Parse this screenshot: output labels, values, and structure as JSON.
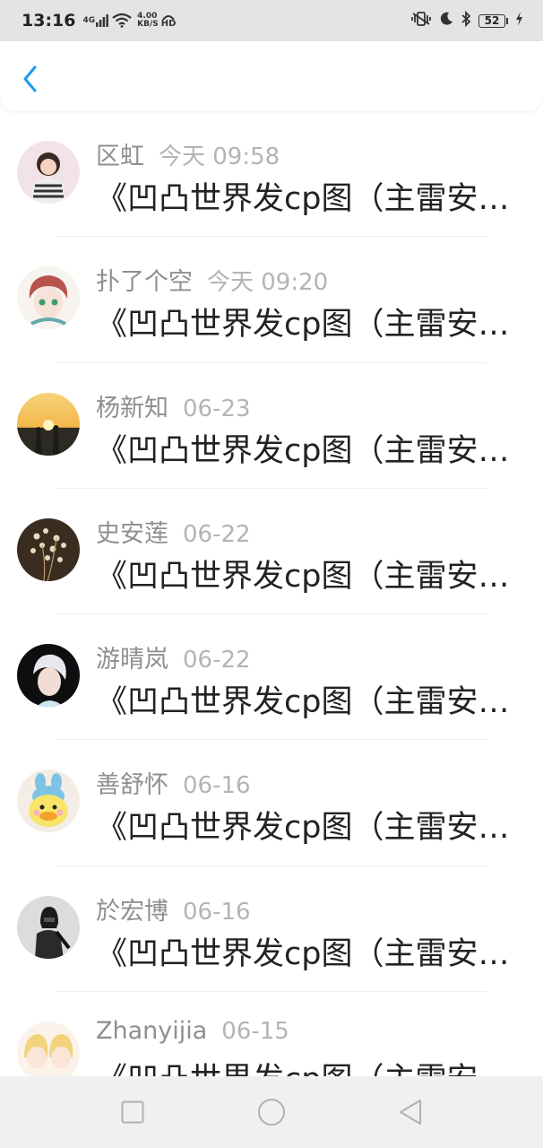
{
  "status_bar": {
    "time": "13:16",
    "network_type": "4G",
    "speed_value": "4.00",
    "speed_unit": "KB/S",
    "hd_label": "HD",
    "battery": "52",
    "icons": [
      "signal-icon",
      "wifi-icon",
      "hd-call-icon",
      "vibrate-icon",
      "moon-icon",
      "bluetooth-icon",
      "battery-icon",
      "charging-icon"
    ]
  },
  "header": {
    "back_icon": "chevron-left-icon",
    "accent": "#1a9bf0"
  },
  "messages": [
    {
      "name": "区虹",
      "time": "今天 09:58",
      "preview": "《凹凸世界发cp图（主雷安…"
    },
    {
      "name": "扑了个空",
      "time": "今天 09:20",
      "preview": "《凹凸世界发cp图（主雷安…"
    },
    {
      "name": "杨新知",
      "time": "06-23",
      "preview": "《凹凸世界发cp图（主雷安…"
    },
    {
      "name": "史安莲",
      "time": "06-22",
      "preview": "《凹凸世界发cp图（主雷安…"
    },
    {
      "name": "游晴岚",
      "time": "06-22",
      "preview": "《凹凸世界发cp图（主雷安…"
    },
    {
      "name": "善舒怀",
      "time": "06-16",
      "preview": "《凹凸世界发cp图（主雷安…"
    },
    {
      "name": "於宏博",
      "time": "06-16",
      "preview": "《凹凸世界发cp图（主雷安…"
    },
    {
      "name": "Zhanyijia",
      "time": "06-15",
      "preview": "《凹凸世界发cp图（主雷安…"
    }
  ],
  "nav": {
    "icons": [
      "square-recent-icon",
      "circle-home-icon",
      "triangle-back-icon"
    ]
  }
}
